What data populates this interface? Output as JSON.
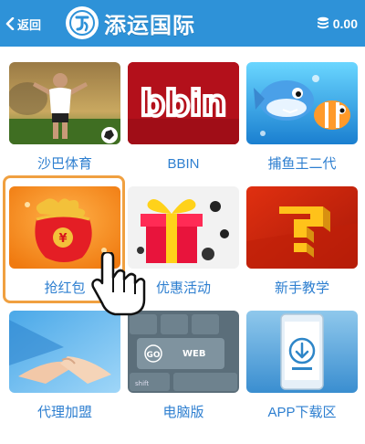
{
  "header": {
    "back_label": "返回",
    "title": "添运国际",
    "balance": "0.00"
  },
  "tiles": [
    {
      "label": "沙巴体育",
      "icon": "soccer-player-thumbnail"
    },
    {
      "label": "BBIN",
      "icon": "bbin-logo-thumbnail",
      "logo_text": "bbin"
    },
    {
      "label": "捕鱼王二代",
      "icon": "cartoon-fish-thumbnail"
    },
    {
      "label": "抢红包",
      "icon": "red-envelope-bag-thumbnail",
      "bag_text": "¥"
    },
    {
      "label": "优惠活动",
      "icon": "gift-box-thumbnail"
    },
    {
      "label": "新手教学",
      "icon": "question-mark-thumbnail"
    },
    {
      "label": "代理加盟",
      "icon": "handshake-thumbnail"
    },
    {
      "label": "电脑版",
      "icon": "keyboard-go-web-thumbnail",
      "key_text": "GO WEB",
      "key_small": "shift"
    },
    {
      "label": "APP下载区",
      "icon": "phone-download-thumbnail"
    }
  ],
  "colors": {
    "header_bg": "#2e92d8",
    "label": "#2e7fd0",
    "highlight_border": "#f0a040"
  }
}
